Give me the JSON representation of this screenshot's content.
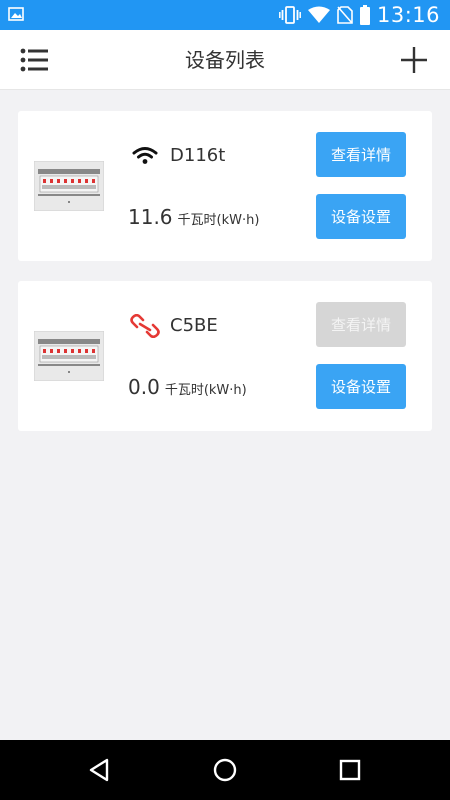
{
  "status_bar": {
    "time": "13:16",
    "icons": [
      "image-icon",
      "vibrate-icon",
      "wifi-icon",
      "no-sim-icon",
      "battery-icon"
    ]
  },
  "app_bar": {
    "title": "设备列表",
    "menu_icon": "list-menu-icon",
    "add_icon": "plus-icon"
  },
  "devices": [
    {
      "name": "D116t",
      "connection": "wifi",
      "energy_value": "11.6",
      "energy_unit": "千瓦时(kW·h)",
      "details_label": "查看详情",
      "details_enabled": true,
      "settings_label": "设备设置"
    },
    {
      "name": "C5BE",
      "connection": "disconnected",
      "energy_value": "0.0",
      "energy_unit": "千瓦时(kW·h)",
      "details_label": "查看详情",
      "details_enabled": false,
      "settings_label": "设备设置"
    }
  ],
  "colors": {
    "status_bar": "#2196f3",
    "button_primary": "#3aa4f4",
    "button_disabled": "#d6d6d6",
    "disconnected": "#e53935",
    "background": "#f2f2f4"
  },
  "nav_bar": {
    "icons": [
      "back-icon",
      "home-icon",
      "recents-icon"
    ]
  }
}
